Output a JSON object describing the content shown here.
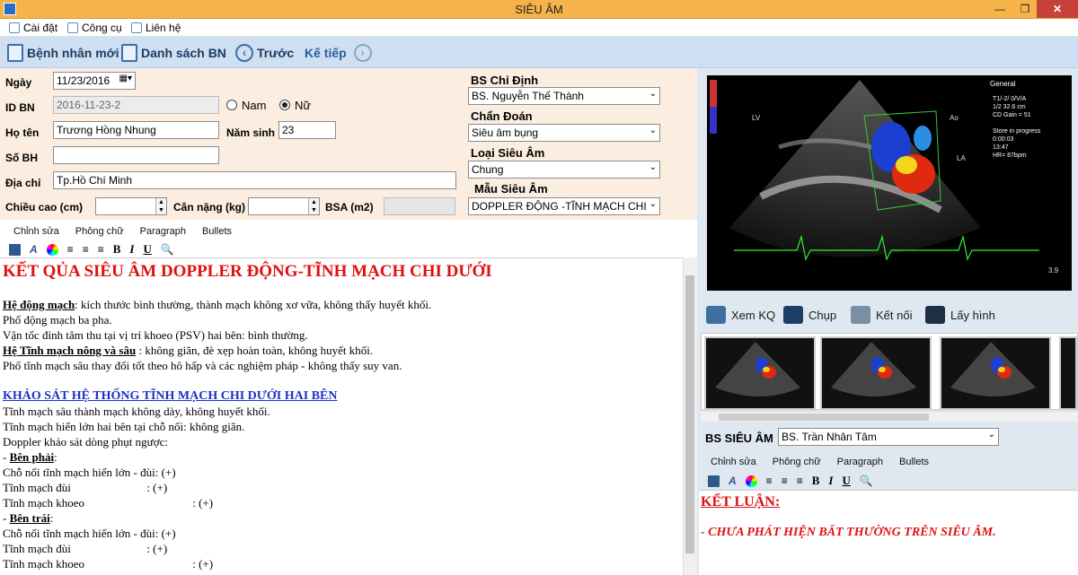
{
  "window": {
    "title": "SIÊU ÂM",
    "minimize": "—",
    "maximize": "❐",
    "close": "✕"
  },
  "menu": {
    "settings": "Cài đặt",
    "tools": "Công cụ",
    "contact": "Liên hệ"
  },
  "toolbar": {
    "new_patient": "Bệnh nhân mới",
    "patient_list": "Danh sách BN",
    "prev": "Trước",
    "next": "Kế tiếp",
    "prev_icon": "‹",
    "next_icon": "›"
  },
  "form": {
    "date_label": "Ngày",
    "date_value": "11/23/2016",
    "id_label": "ID BN",
    "id_value": "2016-11-23-2",
    "male_label": "Nam",
    "female_label": "Nữ",
    "gender_selected": "female",
    "name_label": "Họ tên",
    "name_value": "Trương Hồng Nhung",
    "birth_label": "Năm sinh",
    "birth_value": "23",
    "insurance_label": "Số BH",
    "insurance_value": "",
    "address_label": "Địa chỉ",
    "address_value": "Tp.Hồ Chí Minh",
    "height_label": "Chiều cao (cm)",
    "height_value": "",
    "weight_label": "Cân nặng (kg)",
    "weight_value": "",
    "bsa_label": "BSA (m2)",
    "bsa_value": "",
    "doctor_label": "BS Chỉ Định",
    "doctor_value": "BS. Nguyễn Thế Thành",
    "diagnosis_label": "Chẩn Đoán",
    "diagnosis_value": "Siêu âm bụng",
    "type_label": "Loại Siêu Âm",
    "type_value": "Chung",
    "template_label": "Mẫu Siêu Âm",
    "template_value": "DOPPLER  ĐỘNG -TĨNH MẠCH CHI"
  },
  "editor_tabs": [
    "Chỉnh sửa",
    "Phông chữ",
    "Paragraph",
    "Bullets"
  ],
  "format_icons": [
    "save-icon",
    "font-icon",
    "color-icon",
    "align-left-icon",
    "align-center-icon",
    "align-right-icon",
    "bold-icon",
    "italic-icon",
    "underline-icon",
    "zoom-icon"
  ],
  "format_glyphs": {
    "bold": "B",
    "italic": "I",
    "underline": "U",
    "font": "A"
  },
  "report": {
    "title": "KẾT QỦA SIÊU ÂM DOPPLER ĐỘNG-TĨNH MẠCH CHI DƯỚI",
    "l1_head": "Hệ động mạch",
    "l1_rest": ": kích thước bình thường, thành mạch không xơ vữa, không thấy huyết khối.",
    "l2": "Phổ động mạch ba pha.",
    "l3": "Vận tốc đỉnh tâm thu tại vị trí khoeo (PSV) hai bên: bình thường.",
    "l4_head": "Hệ Tĩnh mạch nông và sâu",
    "l4_rest": " : không giãn, đè xẹp hoàn toàn, không huyết khối.",
    "l5": "Phổ tĩnh mạch sâu thay đổi tốt theo hô hấp và các nghiệm pháp - không thấy suy van.",
    "section2": "KHẢO SÁT HỆ THỐNG TĨNH MẠCH CHI DƯỚI HAI BÊN",
    "l6": "Tĩnh mạch sâu thành mạch không dày, không huyết khối.",
    "l7": "Tĩnh mạch hiển lớn hai bên tại chỗ nối: không giãn.",
    "l8": "Doppler khảo sát dòng phụt ngược:",
    "right_prefix": "- ",
    "right_head": "Bên phải",
    "right_colon": ":",
    "r1": "Chỗ nối tĩnh mạch hiển lớn - đùi: (+)",
    "r2": "Tĩnh mạch đùi                          : (+)",
    "r3": "Tĩnh mạch khoeo                                     : (+)",
    "left_prefix": "- ",
    "left_head": "Bên trái",
    "left_colon": ":",
    "t1": "Chỗ nối tĩnh mạch hiển lớn - đùi: (+)",
    "t2": "Tĩnh mạch đùi                          : (+)",
    "t3": "Tĩnh mạch khoeo                                     : (+)"
  },
  "actions": {
    "view": "Xem KQ",
    "capture": "Chụp",
    "connect": "Kết nối",
    "get_image": "Lấy hình"
  },
  "ultrasound": {
    "general": "General",
    "lv": "LV",
    "ao": "Ao",
    "la": "LA",
    "depth": "3.9",
    "info": "T1/-2/ 0/V/A\n1/2     32.6 cm\nCD Gain = 51\n\nStore in progress\n0:00:03\n13:47\nHR= 87bpm"
  },
  "sonographer": {
    "label": "BS SIÊU ÂM",
    "value": "BS. Trần Nhân Tâm"
  },
  "conclusion": {
    "title": "KẾT LUẬN:",
    "text": "- CHƯA PHÁT HIỆN BẤT THƯỜNG TRÊN SIÊU ÂM."
  },
  "colors": {
    "accent_title": "#f5b34a",
    "toolbar": "#cfe0f2",
    "form_bg": "#fbeee0",
    "report_red": "#e01010",
    "report_blue": "#1a33c8"
  }
}
